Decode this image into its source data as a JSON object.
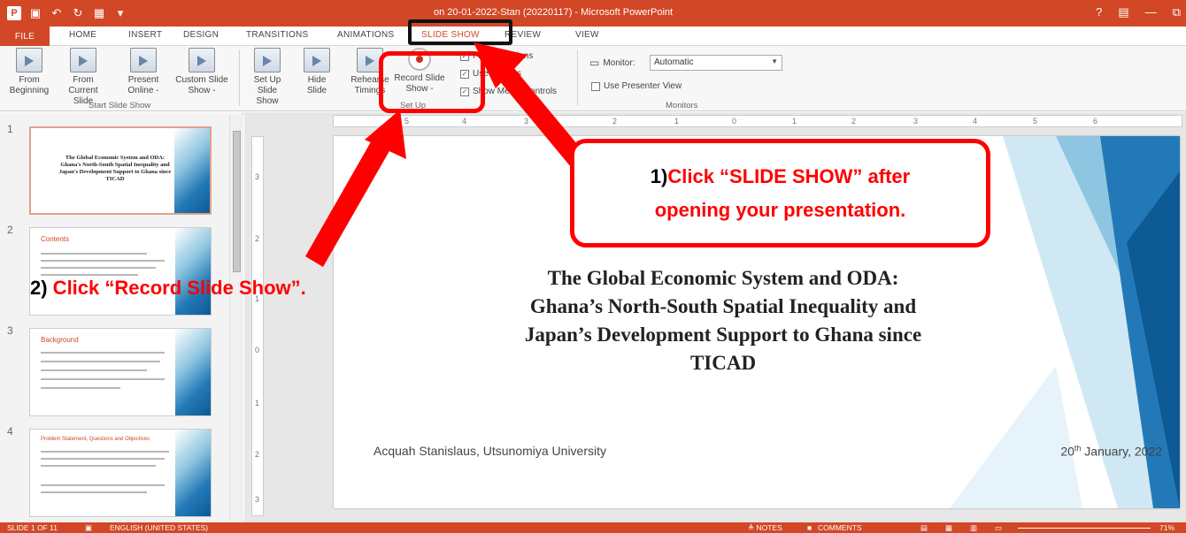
{
  "window": {
    "title": "on 20-01-2022-Stan (20220117) - Microsoft PowerPoint",
    "help": "?",
    "minimize": "—",
    "restore": "⧉"
  },
  "tabs": [
    "FILE",
    "HOME",
    "INSERT",
    "DESIGN",
    "TRANSITIONS",
    "ANIMATIONS",
    "SLIDE SHOW",
    "REVIEW",
    "VIEW"
  ],
  "active_tab": "SLIDE SHOW",
  "ribbon": {
    "from_beginning": "From Beginning",
    "from_current": "From Current Slide",
    "present_online": "Present Online -",
    "custom_slide_show": "Custom Slide Show -",
    "start_group": "Start Slide Show",
    "set_up_slide_show": "Set Up Slide Show",
    "hide_slide": "Hide Slide",
    "rehearse_timings": "Rehearse Timings",
    "record_slide_show": "Record Slide Show -",
    "play_narrations": "Play Narrations",
    "use_timings": "Use Timings",
    "show_media_controls": "Show Media Controls",
    "setup_group": "Set Up",
    "monitor_label": "Monitor:",
    "monitor_value": "Automatic",
    "use_presenter_view": "Use Presenter View",
    "monitors_group": "Monitors"
  },
  "thumbnails": [
    {
      "num": "1",
      "title": "",
      "text": "The Global Economic System and ODA: Ghana's North-South Spatial Inequality and Japan's Development Support to Ghana since TICAD"
    },
    {
      "num": "2",
      "title": "Contents",
      "text": ""
    },
    {
      "num": "3",
      "title": "Background",
      "text": ""
    },
    {
      "num": "4",
      "title": "Problem Statement, Questions and Objectives",
      "text": ""
    }
  ],
  "slide": {
    "title_line1": "The Global Economic System and ODA:",
    "title_line2": "Ghana’s North-South Spatial Inequality and",
    "title_line3": "Japan’s Development Support to Ghana since",
    "title_line4": "TICAD",
    "author": "Acquah Stanislaus, Utsunomiya University",
    "date_day": "20",
    "date_suffix": "th",
    "date_rest": " January, 2022"
  },
  "ruler": {
    "h_ticks": [
      "6",
      "5",
      "4",
      "3",
      "2",
      "1",
      "0",
      "1",
      "2",
      "3",
      "4",
      "5",
      "6"
    ],
    "v_ticks": [
      "3",
      "2",
      "1",
      "0",
      "1",
      "2",
      "3"
    ]
  },
  "statusbar": {
    "slide_of": "SLIDE 1 OF 11",
    "language": "ENGLISH (UNITED STATES)",
    "notes": "≜ NOTES",
    "comments": "COMMENTS",
    "zoom": "71%"
  },
  "annotations": {
    "step1_num": "1)",
    "step1_line1": "Click “SLIDE SHOW” after",
    "step1_line2": "opening your presentation.",
    "step2_num": "2)",
    "step2_text": " Click “Record Slide Show”.",
    "color": "#ff0000"
  },
  "colors": {
    "accent": "#d24726",
    "slide_blue": "#2379b7"
  }
}
